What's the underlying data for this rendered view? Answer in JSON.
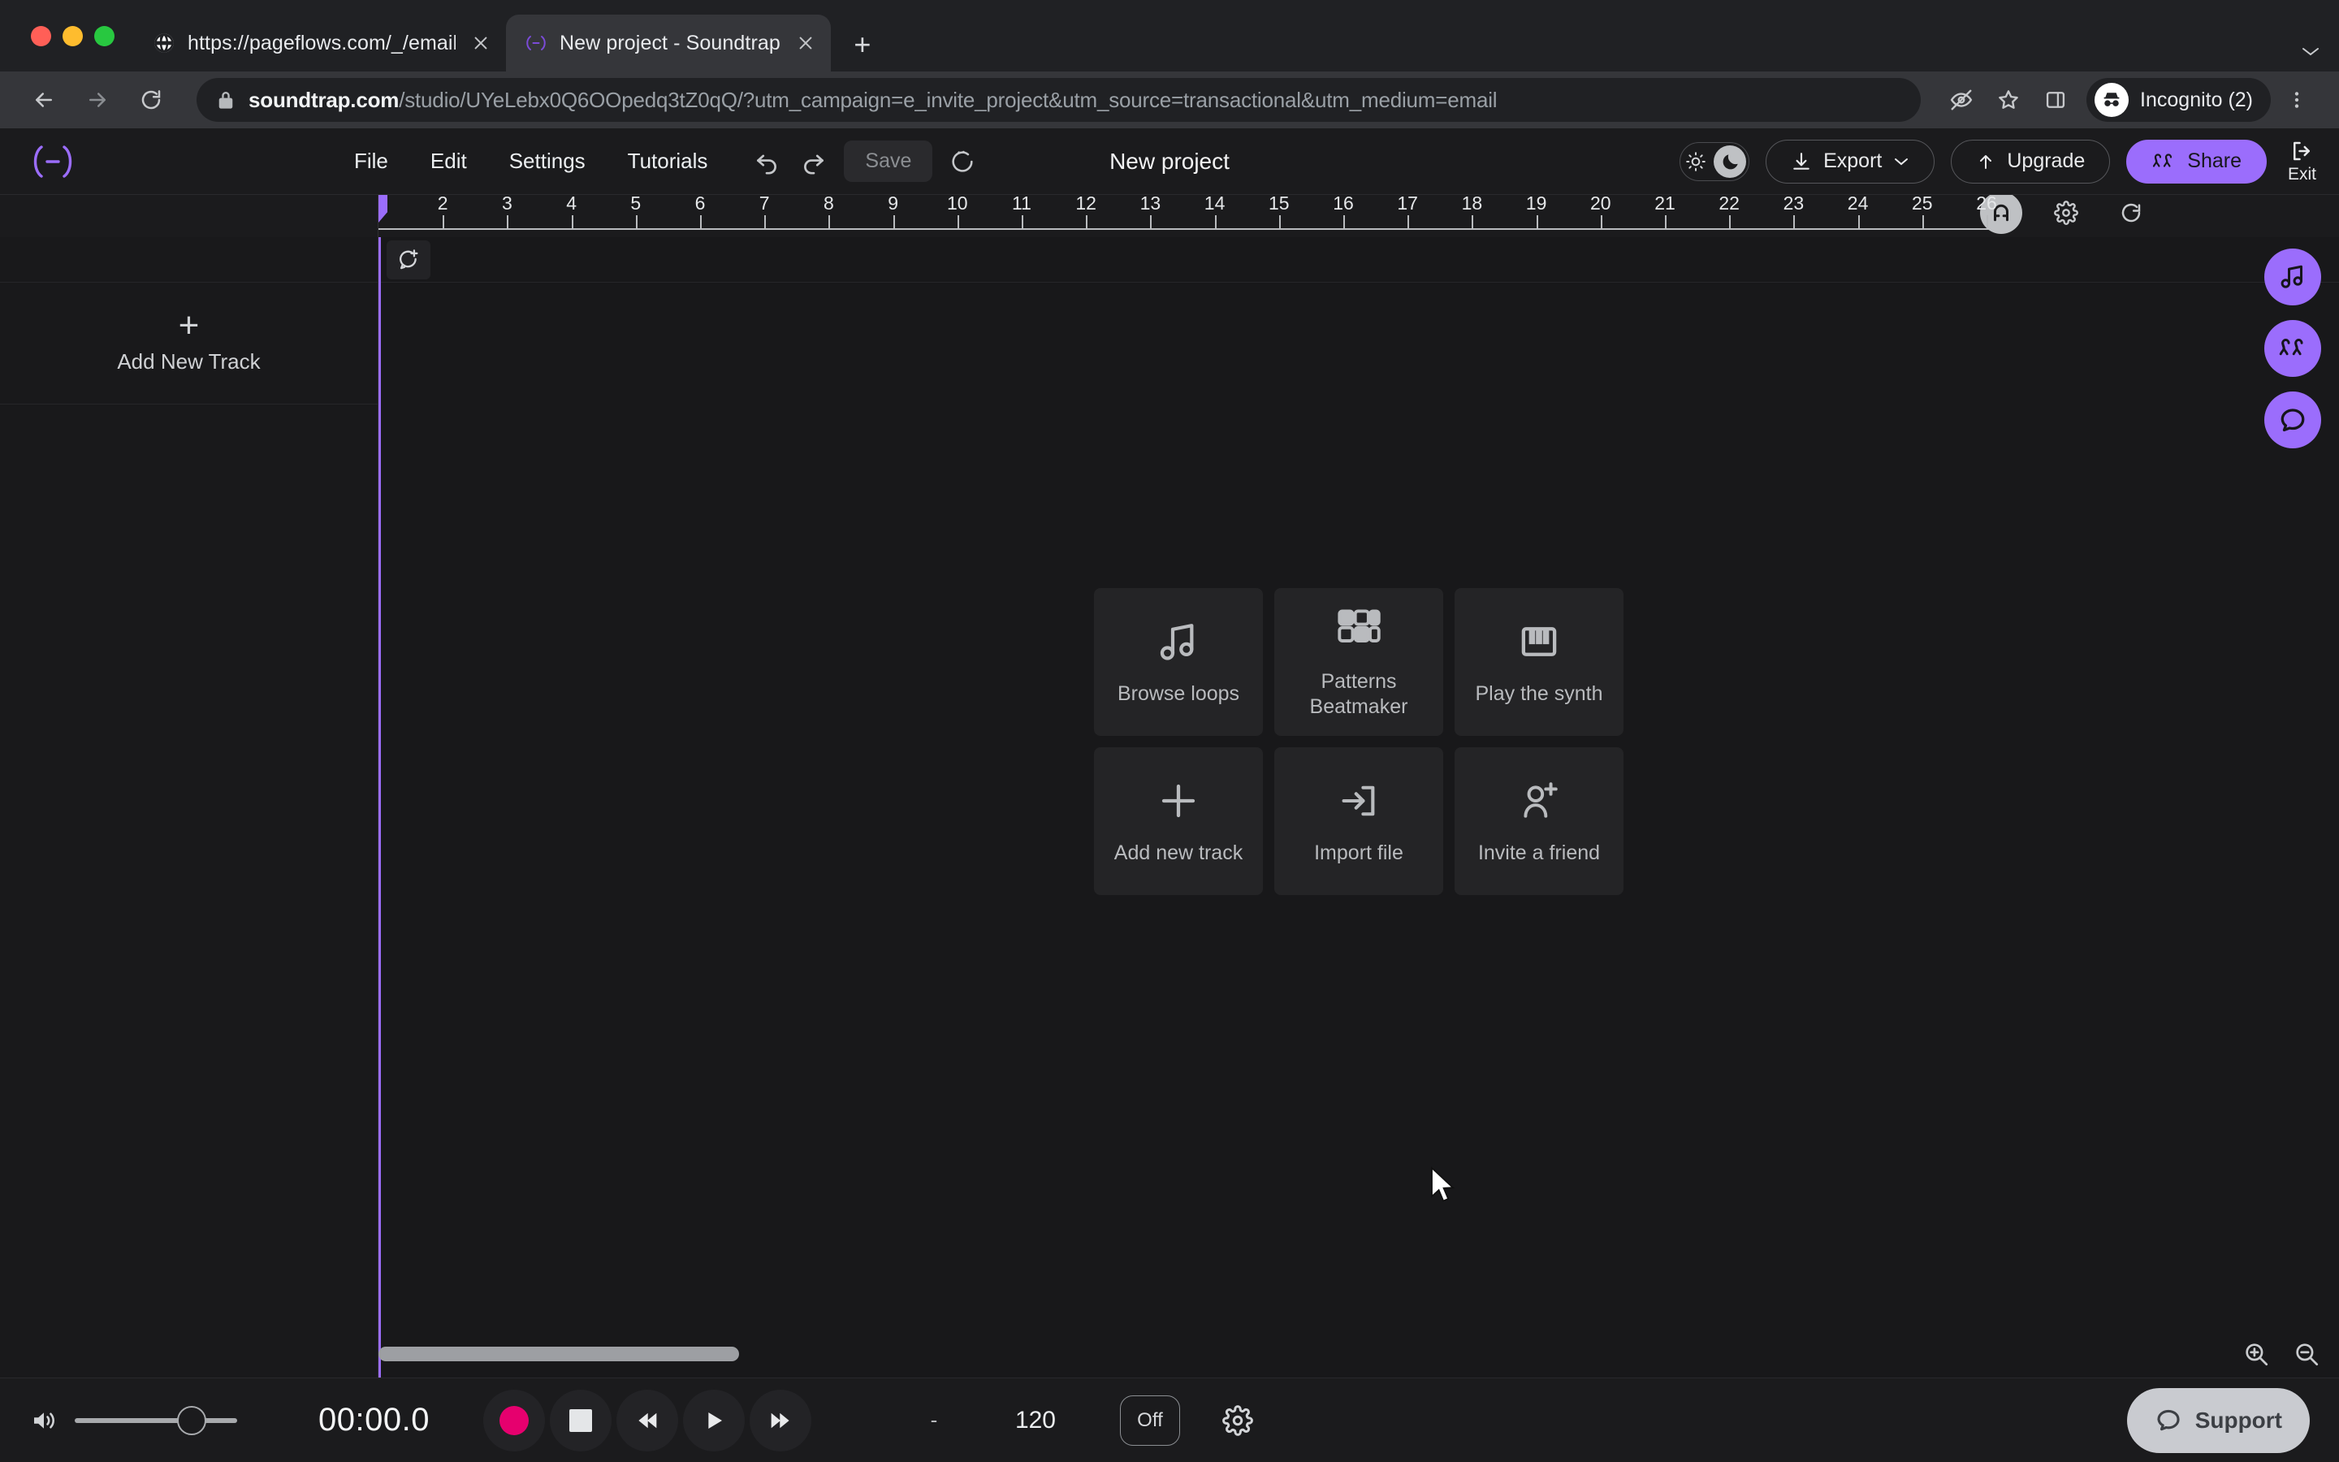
{
  "browser": {
    "tabs": [
      {
        "title": "https://pageflows.com/_/emails",
        "favicon": "globe-icon",
        "active": false
      },
      {
        "title": "New project - Soundtrap",
        "favicon": "soundtrap-icon",
        "active": true
      }
    ],
    "newtab_label": "+",
    "tablist_chevron": "⌄",
    "url": {
      "host": "soundtrap.com",
      "path": "/studio/UYeLebx0Q6OOpedq3tZ0qQ/?utm_campaign=e_invite_project&utm_source=transactional&utm_medium=email",
      "lock_icon": "lock-icon"
    },
    "omnibox_icons": [
      "tracking-protection-off-icon",
      "bookmark-star-icon",
      "side-panel-icon"
    ],
    "profile": {
      "label": "Incognito (2)",
      "icon": "incognito-icon"
    },
    "menu_icon": "three-dot-menu-icon",
    "back_icon": "back-arrow-icon",
    "forward_icon": "forward-arrow-icon",
    "reload_icon": "reload-icon"
  },
  "app": {
    "logo": "(—)",
    "menus": [
      {
        "label": "File"
      },
      {
        "label": "Edit"
      },
      {
        "label": "Settings"
      },
      {
        "label": "Tutorials"
      }
    ],
    "undo_icon": "undo-icon",
    "redo_icon": "redo-icon",
    "save_label": "Save",
    "revert_icon": "revert-history-icon",
    "project_title": "New project",
    "theme": {
      "light_icon": "sun-icon",
      "dark_icon": "moon-icon",
      "selected": "dark"
    },
    "export_label": "Export",
    "export_caret": "⌄",
    "upgrade_label": "Upgrade",
    "share_label": "Share",
    "exit_label": "Exit",
    "ruler": {
      "ticks": [
        2,
        3,
        4,
        5,
        6,
        7,
        8,
        9,
        10,
        11,
        12,
        13,
        14,
        15,
        16,
        17,
        18,
        19,
        20,
        21,
        22,
        23,
        24,
        25,
        26
      ],
      "tools": [
        {
          "name": "magnet-snap-icon",
          "active": true
        },
        {
          "name": "gear-icon",
          "active": false
        },
        {
          "name": "loop-icon",
          "active": false
        }
      ]
    },
    "track_panel": {
      "add_new_track_label": "Add New Track",
      "plus_icon": "plus-icon"
    },
    "canvas": {
      "comment_icon": "add-comment-icon"
    },
    "cards": [
      {
        "label": "Browse loops",
        "icon": "music-note-icon",
        "name": "browse-loops"
      },
      {
        "label": "Patterns Beatmaker",
        "icon": "grid-pads-icon",
        "name": "patterns-beatmaker"
      },
      {
        "label": "Play the synth",
        "icon": "piano-keys-icon",
        "name": "play-the-synth"
      },
      {
        "label": "Add new track",
        "icon": "plus-icon",
        "name": "add-new-track"
      },
      {
        "label": "Import file",
        "icon": "import-arrow-icon",
        "name": "import-file"
      },
      {
        "label": "Invite a friend",
        "icon": "person-plus-icon",
        "name": "invite-a-friend"
      }
    ],
    "right_rail": [
      {
        "name": "sounds-panel",
        "icon": "music-note-icon"
      },
      {
        "name": "collaborators-panel",
        "icon": "people-icon"
      },
      {
        "name": "chat-panel",
        "icon": "chat-bubble-icon"
      }
    ],
    "zoom": {
      "in_icon": "zoom-in-icon",
      "out_icon": "zoom-out-icon"
    },
    "transport": {
      "volume_icon": "speaker-icon",
      "timecode": "00:00.0",
      "record_label": "record-button",
      "stop_label": "stop-button",
      "rewind_label": "rewind-button",
      "play_label": "play-button",
      "forward_label": "fast-forward-button",
      "time_signature": "-",
      "bpm": "120",
      "metronome_state": "Off",
      "metronome_gear_icon": "gear-icon"
    },
    "support": {
      "label": "Support",
      "icon": "chat-bubble-icon"
    }
  },
  "colors": {
    "accent_purple": "#9b6dfc",
    "record_pink": "#e6006e",
    "app_bg": "#1b1b1d",
    "card_bg": "#242426",
    "browser_bg": "#202124",
    "active_tab_bg": "#35363a"
  }
}
